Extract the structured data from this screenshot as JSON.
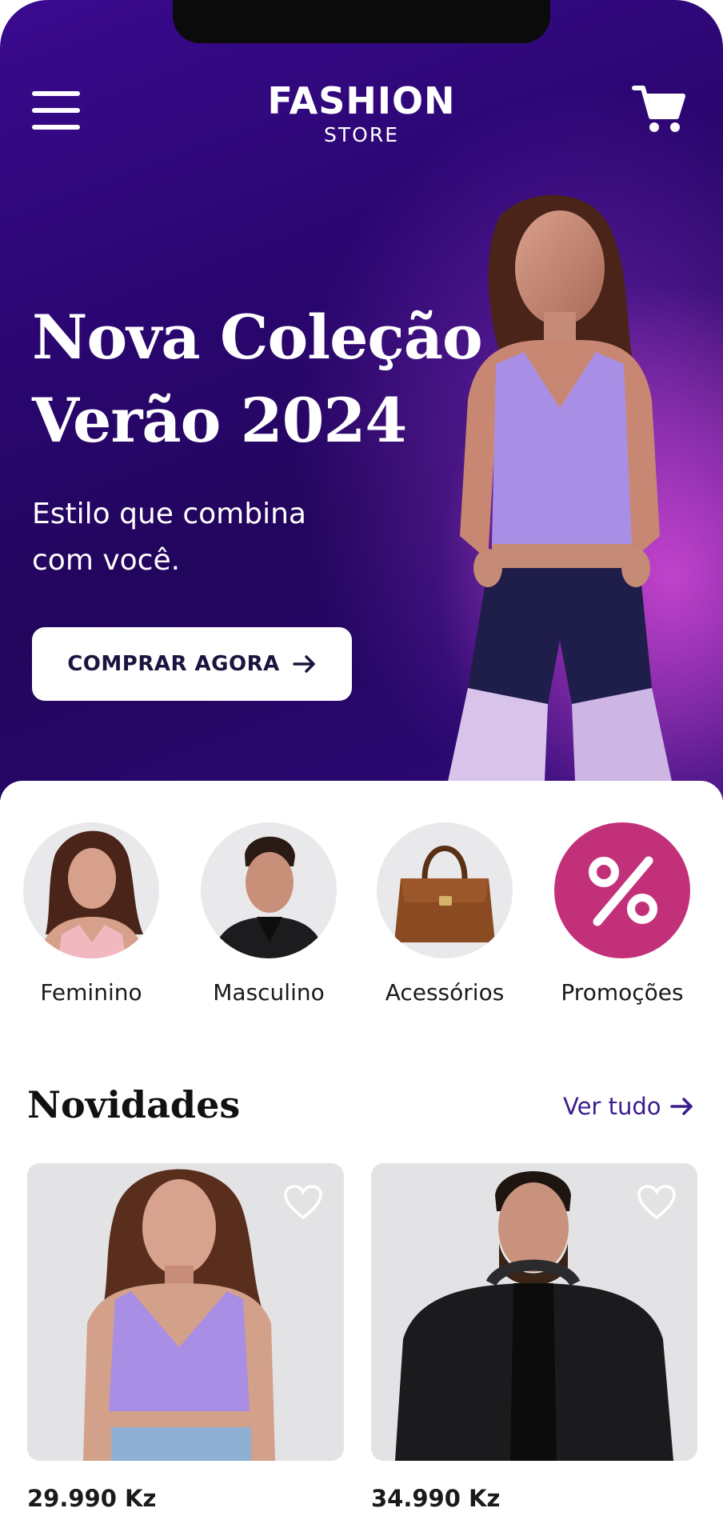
{
  "header": {
    "brand_title": "FASHION",
    "brand_subtitle": "STORE",
    "menu_icon": "hamburger-menu-icon",
    "cart_icon": "shopping-cart-icon"
  },
  "hero": {
    "title_line1": "Nova Coleção",
    "title_line2": "Verão 2024",
    "subtitle_line1": "Estilo que combina",
    "subtitle_line2": "com você.",
    "cta_label": "COMPRAR AGORA",
    "cta_icon": "arrow-right-icon"
  },
  "categories": [
    {
      "label": "Feminino"
    },
    {
      "label": "Masculino"
    },
    {
      "label": "Acessórios"
    },
    {
      "label": "Promoções",
      "icon": "percent-icon"
    }
  ],
  "novidades": {
    "title": "Novidades",
    "see_all_label": "Ver tudo",
    "products": [
      {
        "price": "29.990 Kz",
        "favorite_icon": "heart-icon"
      },
      {
        "price": "34.990 Kz",
        "favorite_icon": "heart-icon"
      }
    ]
  },
  "colors": {
    "hero_dark": "#22055c",
    "hero_accent": "#d64ad6",
    "promo": "#c2307a",
    "link": "#3a1c8c",
    "card_bg": "#e3e3e5"
  }
}
